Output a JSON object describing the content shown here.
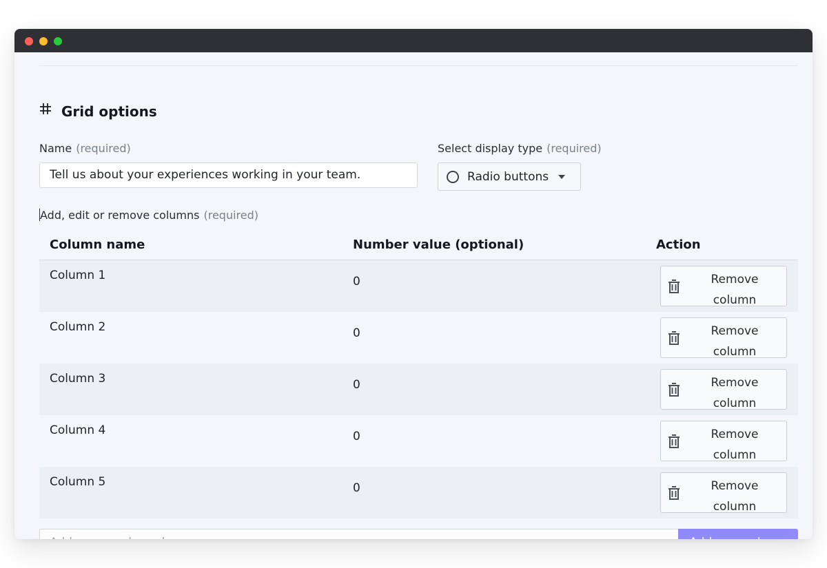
{
  "section": {
    "title": "Grid options",
    "icon": "hash-icon"
  },
  "name_field": {
    "label": "Name",
    "required_note": "(required)",
    "value": "Tell us about your experiences working in your team."
  },
  "display_type": {
    "label": "Select display type",
    "required_note": "(required)",
    "selected": "Radio buttons",
    "icon": "radio-icon"
  },
  "columns_editor": {
    "label": "Add, edit or remove columns",
    "required_note": "(required)",
    "headers": {
      "name": "Column name",
      "value": "Number value (optional)",
      "action": "Action"
    },
    "rows": [
      {
        "name": "Column 1",
        "value": "0",
        "action_label": "Remove column"
      },
      {
        "name": "Column 2",
        "value": "0",
        "action_label": "Remove column"
      },
      {
        "name": "Column 3",
        "value": "0",
        "action_label": "Remove column"
      },
      {
        "name": "Column 4",
        "value": "0",
        "action_label": "Remove column"
      },
      {
        "name": "Column 5",
        "value": "0",
        "action_label": "Remove column"
      }
    ],
    "add_placeholder": "Add a new column here",
    "add_button_label": "Add new column"
  },
  "colors": {
    "accent": "#8b86fb",
    "titlebar": "#2f3033",
    "row_shade": "#edf0f3"
  }
}
